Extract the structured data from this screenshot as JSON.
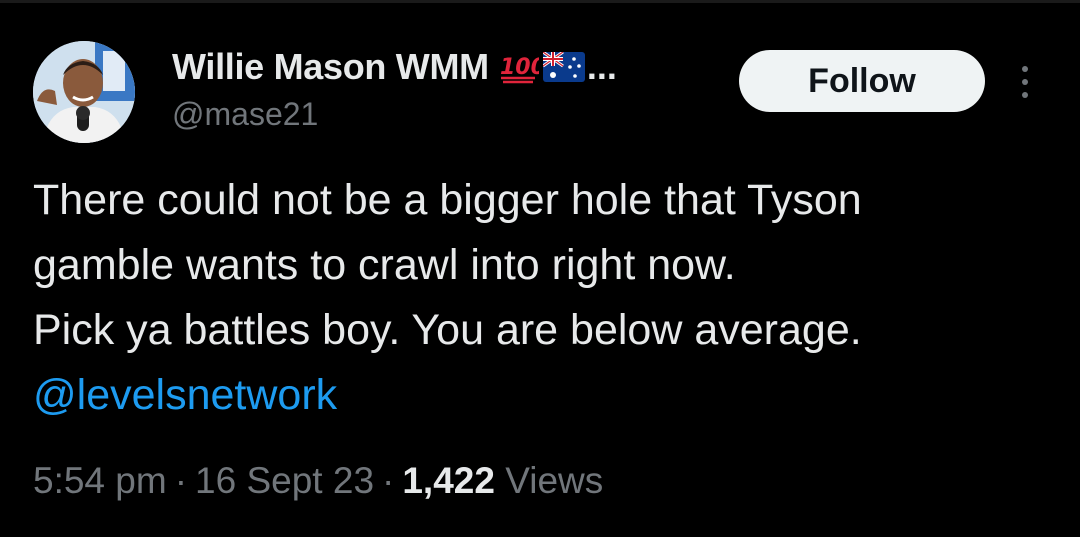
{
  "author": {
    "display_name": "Willie Mason WMM",
    "name_emojis": [
      "hundred-points-emoji",
      "australia-flag-emoji"
    ],
    "truncation": "...",
    "handle": "@mase21"
  },
  "actions": {
    "follow_label": "Follow",
    "more_icon": "more-vertical-icon"
  },
  "tweet": {
    "lines": [
      "There could not be a bigger hole that Tyson",
      "gamble wants to crawl into right now.",
      "Pick ya battles boy. You are below average."
    ],
    "mention": "@levelsnetwork"
  },
  "meta": {
    "time": "5:54 pm",
    "separator": "·",
    "date": "16 Sept 23",
    "views_count": "1,422",
    "views_label": "Views"
  },
  "colors": {
    "background": "#000000",
    "text_primary": "#e7e9ea",
    "text_secondary": "#71767b",
    "link": "#1d9bf0",
    "follow_bg": "#eff3f4",
    "follow_text": "#0f1419"
  }
}
